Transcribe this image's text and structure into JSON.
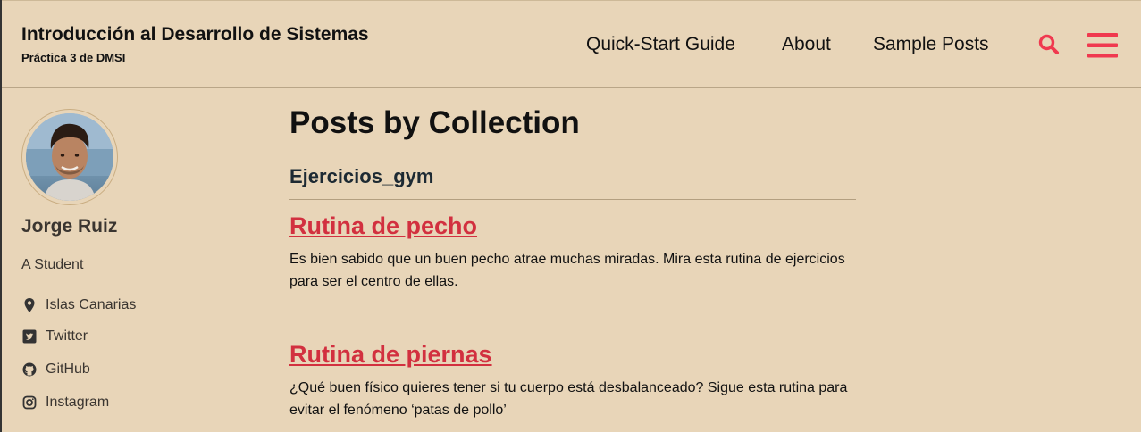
{
  "masthead": {
    "title": "Introducción al Desarrollo de Sistemas",
    "subtitle": "Práctica 3 de DMSI",
    "nav": [
      {
        "label": "Quick-Start Guide"
      },
      {
        "label": "About"
      },
      {
        "label": "Sample Posts"
      }
    ],
    "icons": {
      "search": "search-icon",
      "menu": "hamburger-menu-icon"
    },
    "accent_color": "#f0394f"
  },
  "sidebar": {
    "name": "Jorge Ruiz",
    "bio": "A Student",
    "links": [
      {
        "icon": "map-pin-icon",
        "label": "Islas Canarias"
      },
      {
        "icon": "twitter-icon",
        "label": "Twitter"
      },
      {
        "icon": "github-icon",
        "label": "GitHub"
      },
      {
        "icon": "instagram-icon",
        "label": "Instagram"
      }
    ]
  },
  "main": {
    "title": "Posts by Collection",
    "collection": "Ejercicios_gym",
    "posts": [
      {
        "title": "Rutina de pecho",
        "excerpt": "Es bien sabido que un buen pecho atrae muchas miradas. Mira esta rutina de ejercicios para ser el centro de ellas."
      },
      {
        "title": "Rutina de piernas",
        "excerpt": "¿Qué buen físico quieres tener si tu cuerpo está desbalanceado? Sigue esta rutina para evitar el fenómeno ‘patas de pollo’"
      }
    ]
  },
  "colors": {
    "background": "#e8d5b8",
    "link": "#d2303f",
    "text": "#111111"
  }
}
